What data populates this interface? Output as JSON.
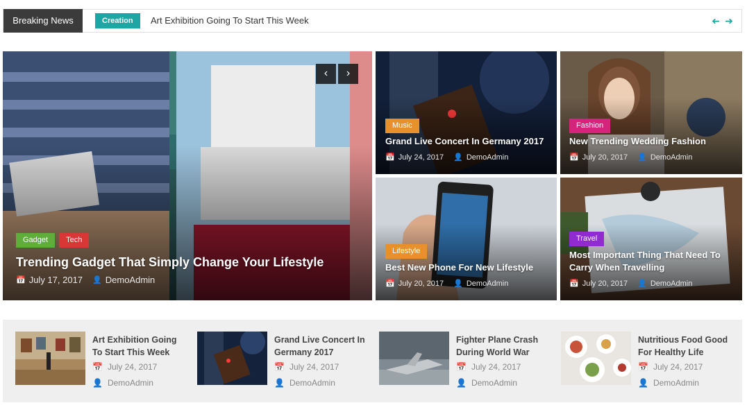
{
  "ticker": {
    "label": "Breaking News",
    "category": "Creation",
    "headline": "Art Exhibition Going To Start This Week",
    "prev_icon": "arrow-left-icon",
    "next_icon": "arrow-right-icon",
    "accent": "#20a5a5"
  },
  "hero": {
    "categories": [
      {
        "label": "Gadget",
        "color": "#5fae3b"
      },
      {
        "label": "Tech",
        "color": "#d93636"
      }
    ],
    "title": "Trending Gadget That Simply Change Your Lifestyle",
    "date": "July 17, 2017",
    "author": "DemoAdmin",
    "prev": "‹",
    "next": "›"
  },
  "tiles": [
    {
      "category": "Music",
      "color": "#e8912c",
      "title": "Grand Live Concert In Germany 2017",
      "date": "July 24, 2017",
      "author": "DemoAdmin"
    },
    {
      "category": "Fashion",
      "color": "#d8237c",
      "title": "New Trending Wedding Fashion",
      "date": "July 20, 2017",
      "author": "DemoAdmin"
    },
    {
      "category": "Lifestyle",
      "color": "#e8912c",
      "title": "Best New Phone For New Lifestyle",
      "date": "July 20, 2017",
      "author": "DemoAdmin"
    },
    {
      "category": "Travel",
      "color": "#8f2bd0",
      "title": "Most Important Thing That Need To Carry When Travelling",
      "date": "July 20, 2017",
      "author": "DemoAdmin"
    }
  ],
  "strip": [
    {
      "title": "Art Exhibition Going To Start This Week",
      "date": "July 24, 2017",
      "author": "DemoAdmin"
    },
    {
      "title": "Grand Live Concert In Germany 2017",
      "date": "July 24, 2017",
      "author": "DemoAdmin"
    },
    {
      "title": "Fighter Plane Crash During World War",
      "date": "July 24, 2017",
      "author": "DemoAdmin"
    },
    {
      "title": "Nutritious Food Good For Healthy Life",
      "date": "July 24, 2017",
      "author": "DemoAdmin"
    }
  ],
  "icons": {
    "date": "calendar-icon",
    "author": "user-icon"
  }
}
